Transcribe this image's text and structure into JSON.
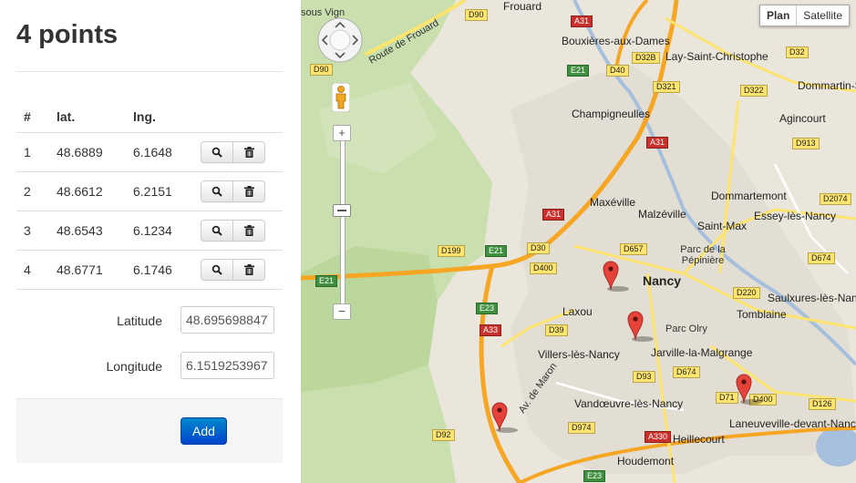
{
  "panel": {
    "title": "4 points",
    "table_headers": [
      "#",
      "lat.",
      "lng."
    ],
    "points": [
      {
        "n": "1",
        "lat": "48.6889",
        "lng": "6.1648"
      },
      {
        "n": "2",
        "lat": "48.6612",
        "lng": "6.2151"
      },
      {
        "n": "3",
        "lat": "48.6543",
        "lng": "6.1234"
      },
      {
        "n": "4",
        "lat": "48.6771",
        "lng": "6.1746"
      }
    ],
    "latitude_label": "Latitude",
    "latitude_value": "48.695698847",
    "longitude_label": "Longitude",
    "longitude_value": "6.1519253967",
    "add_label": "Add"
  },
  "map": {
    "type_plan": "Plan",
    "type_satellite": "Satellite",
    "places": {
      "nancy": "Nancy",
      "laxou": "Laxou",
      "maxeville": "Maxéville",
      "malzeville": "Malzéville",
      "saint_max": "Saint-Max",
      "essey": "Essey-lès-Nancy",
      "villers": "Villers-lès-Nancy",
      "vandoeuvre": "Vandœuvre-lès-Nancy",
      "jarville": "Jarville-la-Malgrange",
      "tomblaine": "Tomblaine",
      "laneuveville": "Laneuveville-devant-Nancy",
      "heillecourt": "Heillecourt",
      "houdemont": "Houdemont",
      "champigneulles": "Champigneulles",
      "bouxieres": "Bouxières-aux-Dames",
      "lay": "Lay-Saint-Christophe",
      "dommartin": "Dommartin-S",
      "agincourt": "Agincourt",
      "dommartemont": "Dommartemont",
      "saulxures": "Saulxures-lès-Nancy",
      "frouard": "Frouard",
      "parc_pepiniere": "Parc de la Pépinière",
      "parc_olry": "Parc Olry",
      "route_frouard": "Route de Frouard",
      "sous_vigne": "sous Vign",
      "av_maron": "Av. de Maron"
    },
    "roads": {
      "d90a": "D90",
      "d90b": "D90",
      "a31a": "A31",
      "e21a": "E21",
      "d40": "D40",
      "d32b": "D32B",
      "d32": "D32",
      "d321": "D321",
      "d322": "D322",
      "d913": "D913",
      "d2074": "D2074",
      "a31b": "A31",
      "a31c": "A31",
      "e21b": "E21",
      "e21c": "E21",
      "d199": "D199",
      "d30": "D30",
      "d657": "D657",
      "d400a": "D400",
      "d400b": "D400",
      "d674a": "D674",
      "d674b": "D674",
      "d220": "D220",
      "e23a": "E23",
      "a33": "A33",
      "d39": "D39",
      "d93": "D93",
      "d71": "D71",
      "d126": "D126",
      "d974": "D974",
      "a330": "A330",
      "d92": "D92",
      "e23b": "E23"
    }
  }
}
